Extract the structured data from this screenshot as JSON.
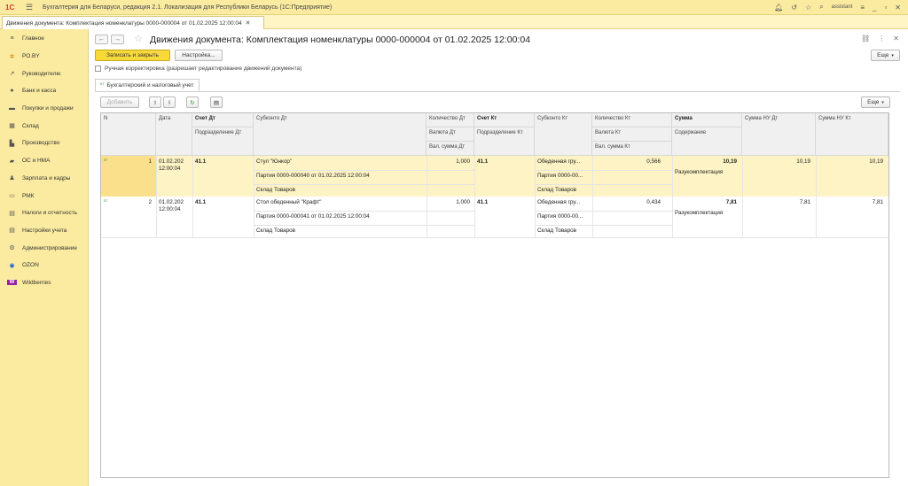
{
  "app": {
    "logo": "1С",
    "title": "Бухгалтерия для Беларуси, редакция 2.1. Локализация для Республики Беларусь   (1С:Предприятие)",
    "user": "assistant"
  },
  "open_tab": {
    "label": "Движения документа: Комплектация номенклатуры 0000-000004 от 01.02.2025 12:00:04"
  },
  "sidebar": {
    "items": [
      {
        "label": "Главное",
        "icon": "menu-icon",
        "glyph": "≡"
      },
      {
        "label": "РО.BY",
        "icon": "star-icon",
        "glyph": "✲"
      },
      {
        "label": "Руководителю",
        "icon": "trend-icon",
        "glyph": "↗"
      },
      {
        "label": "Банк и касса",
        "icon": "coins-icon",
        "glyph": "●"
      },
      {
        "label": "Покупки и продажи",
        "icon": "cart-icon",
        "glyph": "▬"
      },
      {
        "label": "Склад",
        "icon": "warehouse-icon",
        "glyph": "▦"
      },
      {
        "label": "Производство",
        "icon": "factory-icon",
        "glyph": "▙"
      },
      {
        "label": "ОС и НМА",
        "icon": "truck-icon",
        "glyph": "▰"
      },
      {
        "label": "Зарплата и кадры",
        "icon": "person-icon",
        "glyph": "♟"
      },
      {
        "label": "РМК",
        "icon": "register-icon",
        "glyph": "▭"
      },
      {
        "label": "Налоги и отчетность",
        "icon": "chart-icon",
        "glyph": "▤"
      },
      {
        "label": "Настройки учета",
        "icon": "settings-list-icon",
        "glyph": "▤"
      },
      {
        "label": "Администрирование",
        "icon": "gear-icon",
        "glyph": "⚙"
      },
      {
        "label": "OZON",
        "icon": "ozon-icon",
        "glyph": "◉"
      },
      {
        "label": "Wildberries",
        "icon": "wildberries-icon",
        "glyph": "W"
      }
    ]
  },
  "header": {
    "title": "Движения документа: Комплектация номенклатуры 0000-000004 от 01.02.2025 12:00:04",
    "save_close": "Записать и закрыть",
    "settings": "Настройка...",
    "more": "Еще",
    "manual_edit": "Ручная корректировка (разрешает редактирование движений документа)"
  },
  "subtab": {
    "label": "Бухгалтерский и налоговый учет"
  },
  "table_toolbar": {
    "add": "Добавить",
    "more": "Еще"
  },
  "table": {
    "headers": {
      "n": "N",
      "date": "Дата",
      "acc_dt": "Счет Дт",
      "dept_dt": "Подразделение Дт",
      "subconto_dt": "Субконто Дт",
      "qty_dt": "Количество Дт",
      "curr_dt": "Валюта Дт",
      "cur_sum_dt": "Вал. сумма Дт",
      "acc_kt": "Счет Кт",
      "dept_kt": "Подразделение Кт",
      "subconto_kt": "Субконто Кт",
      "qty_kt": "Количество Кт",
      "curr_kt": "Валюта Кт",
      "cur_sum_kt": "Вал. сумма Кт",
      "sum": "Сумма",
      "content": "Содержание",
      "sum_nu_dt": "Сумма НУ Дт",
      "sum_nu_kt": "Сумма НУ Кт"
    },
    "rows": [
      {
        "n": "1",
        "date1": "01.02.202",
        "date2": "12:00:04",
        "acc_dt": "41.1",
        "subconto_dt": [
          "Стул \"Юнкор\"",
          "Партия 0000-000040 от 01.02.2025 12:00:04",
          "Склад Товаров"
        ],
        "qty_dt": "1,000",
        "acc_kt": "41.1",
        "subconto_kt": [
          "Обеденная гру...",
          "Партия 0000-00...",
          "Склад Товаров"
        ],
        "qty_kt": "0,566",
        "sum": "10,19",
        "content": "Разукомплектация",
        "sum_nu_dt": "10,19",
        "sum_nu_kt": "10,19"
      },
      {
        "n": "2",
        "date1": "01.02.202",
        "date2": "12:00:04",
        "acc_dt": "41.1",
        "subconto_dt": [
          "Стол обеденный \"Крафт\"",
          "Партия 0000-000041 от 01.02.2025 12:00:04",
          "Склад Товаров"
        ],
        "qty_dt": "1,000",
        "acc_kt": "41.1",
        "subconto_kt": [
          "Обеденная гру...",
          "Партия 0000-00...",
          "Склад Товаров"
        ],
        "qty_kt": "0,434",
        "sum": "7,81",
        "content": "Разукомплектация",
        "sum_nu_dt": "7,81",
        "sum_nu_kt": "7,81"
      }
    ]
  }
}
